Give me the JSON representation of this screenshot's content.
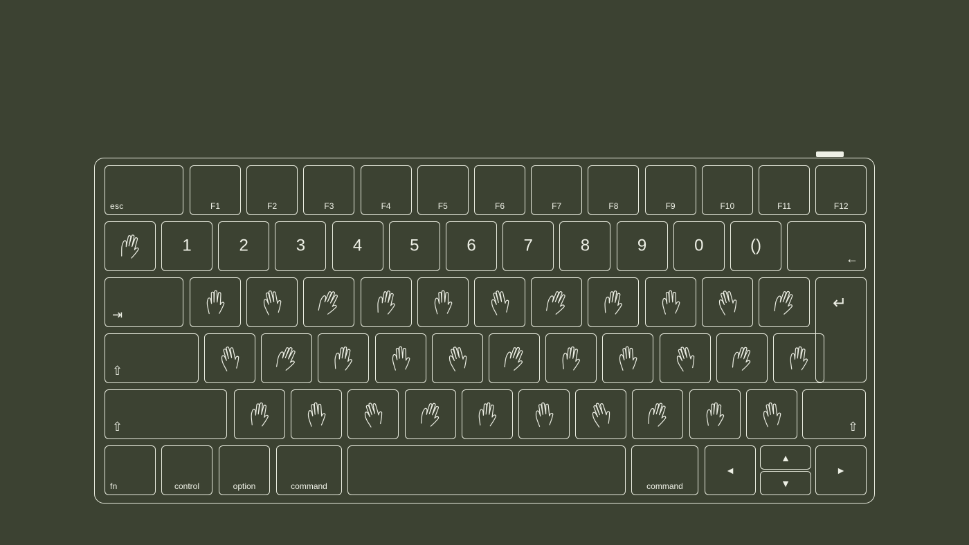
{
  "function_row": [
    "esc",
    "F1",
    "F2",
    "F3",
    "F4",
    "F5",
    "F6",
    "F7",
    "F8",
    "F9",
    "F10",
    "F11",
    "F12"
  ],
  "number_row": [
    "1",
    "2",
    "3",
    "4",
    "5",
    "6",
    "7",
    "8",
    "9",
    "0",
    "()"
  ],
  "arrows": {
    "backspace": "←",
    "tab": "⇥",
    "enter": "↵",
    "shift": "⇧",
    "left": "◄",
    "up": "▲",
    "down": "▼",
    "right": "►"
  },
  "bottom_row": {
    "fn": "fn",
    "control": "control",
    "option": "option",
    "command_left": "command",
    "command_right": "command"
  },
  "colors": {
    "background": "#3c4232",
    "line": "#e9ecdf"
  }
}
